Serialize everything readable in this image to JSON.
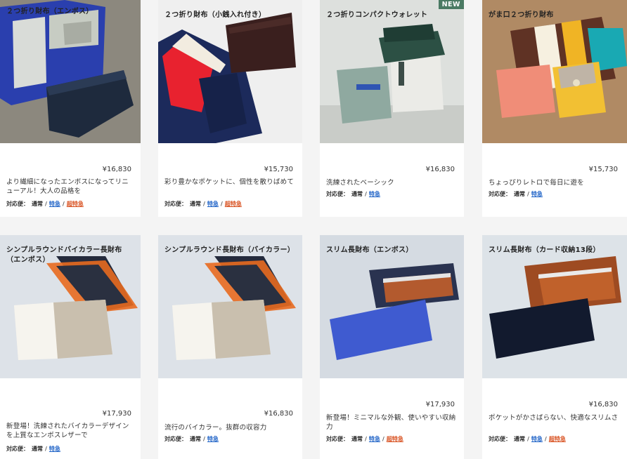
{
  "badges": {
    "new": "NEW"
  },
  "shipping": {
    "label": "対応便：",
    "normal": "通常",
    "express": "特急",
    "super": "超特急",
    "sep": "/"
  },
  "colors": {
    "express": "#1f63c7",
    "super_express": "#d8501f",
    "badge_bg": "#4a7a63"
  },
  "products": [
    {
      "name": "２つ折り財布（エンボス）",
      "price": "¥16,830",
      "desc": "より繊細になったエンボスになってリニューアル！大人の品格を",
      "shipping": [
        "normal",
        "express",
        "super"
      ],
      "is_new": false
    },
    {
      "name": "２つ折り財布（小銭入れ付き）",
      "price": "¥15,730",
      "desc": "彩り豊かなポケットに、個性を散りばめて",
      "shipping": [
        "normal",
        "express",
        "super"
      ],
      "is_new": false
    },
    {
      "name": "２つ折りコンパクトウォレット",
      "price": "¥16,830",
      "desc": "洗練されたベーシック",
      "shipping": [
        "normal",
        "express"
      ],
      "is_new": true
    },
    {
      "name": "がま口２つ折り財布",
      "price": "¥15,730",
      "desc": "ちょっぴりレトロで毎日に遊を",
      "shipping": [
        "normal",
        "express"
      ],
      "is_new": false
    },
    {
      "name": "シンプルラウンドバイカラー長財布（エンボス）",
      "price": "¥17,930",
      "desc": "新登場！洗練されたバイカラーデザインを上質なエンボスレザーで",
      "shipping": [
        "normal",
        "express"
      ],
      "is_new": false
    },
    {
      "name": "シンプルラウンド長財布（バイカラー）",
      "price": "¥16,830",
      "desc": "流行のバイカラー。抜群の収容力",
      "shipping": [
        "normal",
        "express"
      ],
      "is_new": false
    },
    {
      "name": "スリム長財布（エンボス）",
      "price": "¥17,930",
      "desc": "新登場！ミニマルな外観、使いやすい収納力",
      "shipping": [
        "normal",
        "express",
        "super"
      ],
      "is_new": false
    },
    {
      "name": "スリム長財布（カード収納13段）",
      "price": "¥16,830",
      "desc": "ポケットがかさばらない、快適なスリムさ",
      "shipping": [
        "normal",
        "express",
        "super"
      ],
      "is_new": false
    }
  ]
}
